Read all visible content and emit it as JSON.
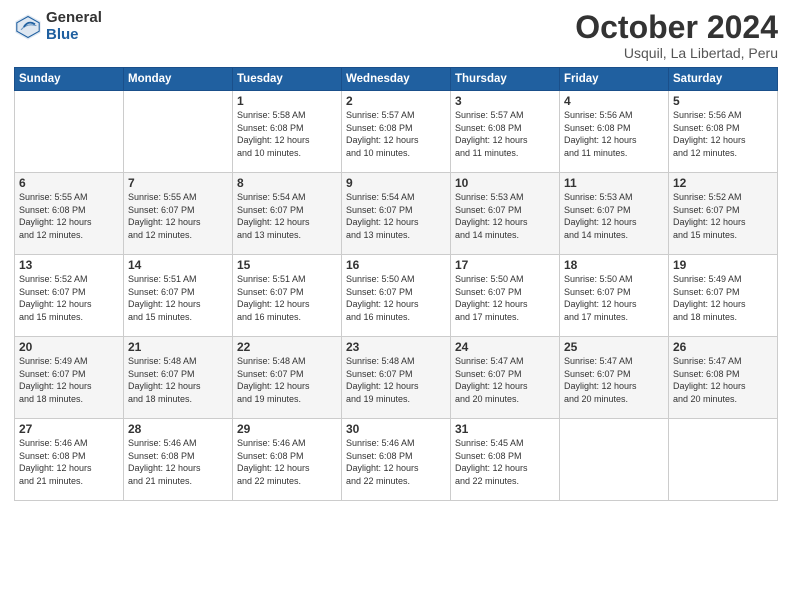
{
  "logo": {
    "general": "General",
    "blue": "Blue"
  },
  "header": {
    "month": "October 2024",
    "location": "Usquil, La Libertad, Peru"
  },
  "weekdays": [
    "Sunday",
    "Monday",
    "Tuesday",
    "Wednesday",
    "Thursday",
    "Friday",
    "Saturday"
  ],
  "weeks": [
    [
      {
        "day": "",
        "info": ""
      },
      {
        "day": "",
        "info": ""
      },
      {
        "day": "1",
        "info": "Sunrise: 5:58 AM\nSunset: 6:08 PM\nDaylight: 12 hours\nand 10 minutes."
      },
      {
        "day": "2",
        "info": "Sunrise: 5:57 AM\nSunset: 6:08 PM\nDaylight: 12 hours\nand 10 minutes."
      },
      {
        "day": "3",
        "info": "Sunrise: 5:57 AM\nSunset: 6:08 PM\nDaylight: 12 hours\nand 11 minutes."
      },
      {
        "day": "4",
        "info": "Sunrise: 5:56 AM\nSunset: 6:08 PM\nDaylight: 12 hours\nand 11 minutes."
      },
      {
        "day": "5",
        "info": "Sunrise: 5:56 AM\nSunset: 6:08 PM\nDaylight: 12 hours\nand 12 minutes."
      }
    ],
    [
      {
        "day": "6",
        "info": "Sunrise: 5:55 AM\nSunset: 6:08 PM\nDaylight: 12 hours\nand 12 minutes."
      },
      {
        "day": "7",
        "info": "Sunrise: 5:55 AM\nSunset: 6:07 PM\nDaylight: 12 hours\nand 12 minutes."
      },
      {
        "day": "8",
        "info": "Sunrise: 5:54 AM\nSunset: 6:07 PM\nDaylight: 12 hours\nand 13 minutes."
      },
      {
        "day": "9",
        "info": "Sunrise: 5:54 AM\nSunset: 6:07 PM\nDaylight: 12 hours\nand 13 minutes."
      },
      {
        "day": "10",
        "info": "Sunrise: 5:53 AM\nSunset: 6:07 PM\nDaylight: 12 hours\nand 14 minutes."
      },
      {
        "day": "11",
        "info": "Sunrise: 5:53 AM\nSunset: 6:07 PM\nDaylight: 12 hours\nand 14 minutes."
      },
      {
        "day": "12",
        "info": "Sunrise: 5:52 AM\nSunset: 6:07 PM\nDaylight: 12 hours\nand 15 minutes."
      }
    ],
    [
      {
        "day": "13",
        "info": "Sunrise: 5:52 AM\nSunset: 6:07 PM\nDaylight: 12 hours\nand 15 minutes."
      },
      {
        "day": "14",
        "info": "Sunrise: 5:51 AM\nSunset: 6:07 PM\nDaylight: 12 hours\nand 15 minutes."
      },
      {
        "day": "15",
        "info": "Sunrise: 5:51 AM\nSunset: 6:07 PM\nDaylight: 12 hours\nand 16 minutes."
      },
      {
        "day": "16",
        "info": "Sunrise: 5:50 AM\nSunset: 6:07 PM\nDaylight: 12 hours\nand 16 minutes."
      },
      {
        "day": "17",
        "info": "Sunrise: 5:50 AM\nSunset: 6:07 PM\nDaylight: 12 hours\nand 17 minutes."
      },
      {
        "day": "18",
        "info": "Sunrise: 5:50 AM\nSunset: 6:07 PM\nDaylight: 12 hours\nand 17 minutes."
      },
      {
        "day": "19",
        "info": "Sunrise: 5:49 AM\nSunset: 6:07 PM\nDaylight: 12 hours\nand 18 minutes."
      }
    ],
    [
      {
        "day": "20",
        "info": "Sunrise: 5:49 AM\nSunset: 6:07 PM\nDaylight: 12 hours\nand 18 minutes."
      },
      {
        "day": "21",
        "info": "Sunrise: 5:48 AM\nSunset: 6:07 PM\nDaylight: 12 hours\nand 18 minutes."
      },
      {
        "day": "22",
        "info": "Sunrise: 5:48 AM\nSunset: 6:07 PM\nDaylight: 12 hours\nand 19 minutes."
      },
      {
        "day": "23",
        "info": "Sunrise: 5:48 AM\nSunset: 6:07 PM\nDaylight: 12 hours\nand 19 minutes."
      },
      {
        "day": "24",
        "info": "Sunrise: 5:47 AM\nSunset: 6:07 PM\nDaylight: 12 hours\nand 20 minutes."
      },
      {
        "day": "25",
        "info": "Sunrise: 5:47 AM\nSunset: 6:07 PM\nDaylight: 12 hours\nand 20 minutes."
      },
      {
        "day": "26",
        "info": "Sunrise: 5:47 AM\nSunset: 6:08 PM\nDaylight: 12 hours\nand 20 minutes."
      }
    ],
    [
      {
        "day": "27",
        "info": "Sunrise: 5:46 AM\nSunset: 6:08 PM\nDaylight: 12 hours\nand 21 minutes."
      },
      {
        "day": "28",
        "info": "Sunrise: 5:46 AM\nSunset: 6:08 PM\nDaylight: 12 hours\nand 21 minutes."
      },
      {
        "day": "29",
        "info": "Sunrise: 5:46 AM\nSunset: 6:08 PM\nDaylight: 12 hours\nand 22 minutes."
      },
      {
        "day": "30",
        "info": "Sunrise: 5:46 AM\nSunset: 6:08 PM\nDaylight: 12 hours\nand 22 minutes."
      },
      {
        "day": "31",
        "info": "Sunrise: 5:45 AM\nSunset: 6:08 PM\nDaylight: 12 hours\nand 22 minutes."
      },
      {
        "day": "",
        "info": ""
      },
      {
        "day": "",
        "info": ""
      }
    ]
  ]
}
